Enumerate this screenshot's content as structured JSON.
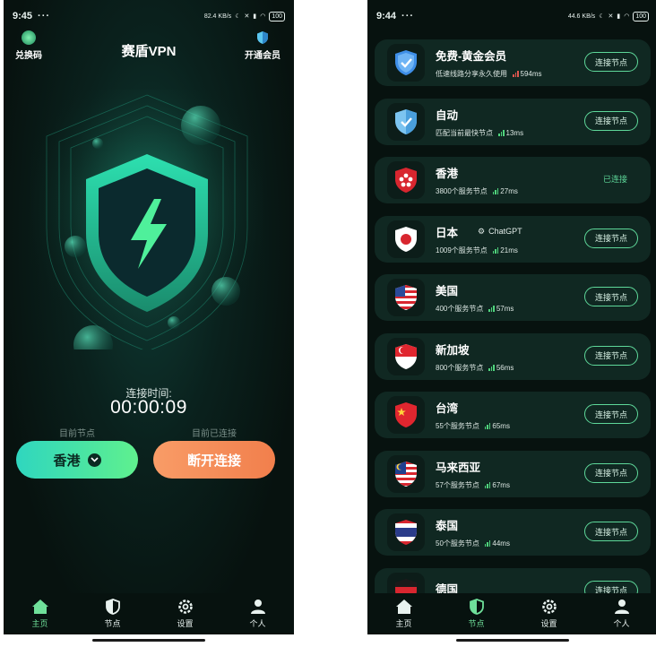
{
  "left": {
    "status": {
      "time": "9:45",
      "dots": "···",
      "net_speed": "82.4 KB/s",
      "battery": "100"
    },
    "redeem_label": "兑换码",
    "title": "赛盾VPN",
    "vip_label": "开通会员",
    "timer_label": "连接时间:",
    "timer": "00:00:09",
    "current_node_caption": "目前节点",
    "connected_caption": "目前已连接",
    "node_button": "香港",
    "disconnect_button": "断开连接",
    "tabs": [
      {
        "label": "主页"
      },
      {
        "label": "节点"
      },
      {
        "label": "设置"
      },
      {
        "label": "个人"
      }
    ]
  },
  "right": {
    "status": {
      "time": "9:44",
      "dots": "···",
      "net_speed": "44.6 KB/s",
      "battery": "100"
    },
    "connect_label": "连接节点",
    "nodes": [
      {
        "name": "免费-黄金会员",
        "desc": "低速线路分享永久使用",
        "ping": "594ms",
        "signal": "red",
        "icon": "shield-blue-icon",
        "action": "button"
      },
      {
        "name": "自动",
        "desc": "匹配当前最快节点",
        "ping": "13ms",
        "signal": "green",
        "icon": "shield-sky-icon",
        "action": "button"
      },
      {
        "name": "香港",
        "desc": "3800个服务节点",
        "ping": "27ms",
        "signal": "green",
        "icon": "hong-kong-flag-icon",
        "action": "status",
        "status": "已连接"
      },
      {
        "name": "日本",
        "tag": "ChatGPT",
        "desc": "1009个服务节点",
        "ping": "21ms",
        "signal": "green",
        "icon": "japan-flag-icon",
        "action": "button"
      },
      {
        "name": "美国",
        "desc": "400个服务节点",
        "ping": "57ms",
        "signal": "green",
        "icon": "usa-flag-icon",
        "action": "button"
      },
      {
        "name": "新加坡",
        "desc": "800个服务节点",
        "ping": "56ms",
        "signal": "green",
        "icon": "singapore-flag-icon",
        "action": "button"
      },
      {
        "name": "台湾",
        "desc": "55个服务节点",
        "ping": "65ms",
        "signal": "green",
        "icon": "china-flag-icon",
        "action": "button"
      },
      {
        "name": "马来西亚",
        "desc": "57个服务节点",
        "ping": "67ms",
        "signal": "green",
        "icon": "malaysia-flag-icon",
        "action": "button"
      },
      {
        "name": "泰国",
        "desc": "50个服务节点",
        "ping": "44ms",
        "signal": "green",
        "icon": "thailand-flag-icon",
        "action": "button"
      },
      {
        "name": "德国",
        "desc": "",
        "ping": "",
        "signal": "green",
        "icon": "germany-flag-icon",
        "action": "button"
      }
    ],
    "tabs": [
      {
        "label": "主页"
      },
      {
        "label": "节点"
      },
      {
        "label": "设置"
      },
      {
        "label": "个人"
      }
    ]
  },
  "colors": {
    "accent": "#5ed89a",
    "orange": "#f17f4c",
    "card": "#102822",
    "bg": "#07120f"
  }
}
